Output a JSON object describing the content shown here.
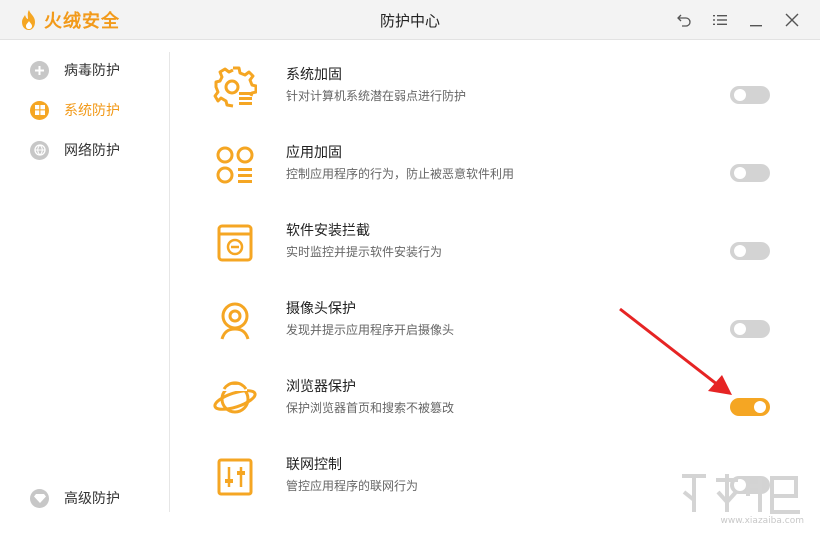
{
  "app": {
    "logo_text": "火绒安全",
    "window_title": "防护中心",
    "brand_color": "#f5a623"
  },
  "window_controls": [
    {
      "name": "back-icon"
    },
    {
      "name": "menu-icon"
    },
    {
      "name": "minimize-icon"
    },
    {
      "name": "close-icon"
    }
  ],
  "sidebar": {
    "items": [
      {
        "label": "病毒防护",
        "icon": "virus-shield-icon",
        "active": false
      },
      {
        "label": "系统防护",
        "icon": "windows-icon",
        "active": true
      },
      {
        "label": "网络防护",
        "icon": "globe-icon",
        "active": false
      }
    ],
    "bottom_item": {
      "label": "高级防护",
      "icon": "diamond-icon"
    }
  },
  "features": [
    {
      "title": "系统加固",
      "desc": "针对计算机系统潜在弱点进行防护",
      "icon": "system-gear-icon",
      "enabled": false
    },
    {
      "title": "应用加固",
      "desc": "控制应用程序的行为，防止被恶意软件利用",
      "icon": "app-grid-icon",
      "enabled": false
    },
    {
      "title": "软件安装拦截",
      "desc": "实时监控并提示软件安装行为",
      "icon": "install-box-icon",
      "enabled": false
    },
    {
      "title": "摄像头保护",
      "desc": "发现并提示应用程序开启摄像头",
      "icon": "webcam-icon",
      "enabled": false
    },
    {
      "title": "浏览器保护",
      "desc": "保护浏览器首页和搜索不被篡改",
      "icon": "planet-browser-icon",
      "enabled": true
    },
    {
      "title": "联网控制",
      "desc": "管控应用程序的联网行为",
      "icon": "network-sliders-icon",
      "enabled": false
    }
  ],
  "watermark": {
    "site": "www.xiazaiba.com"
  }
}
